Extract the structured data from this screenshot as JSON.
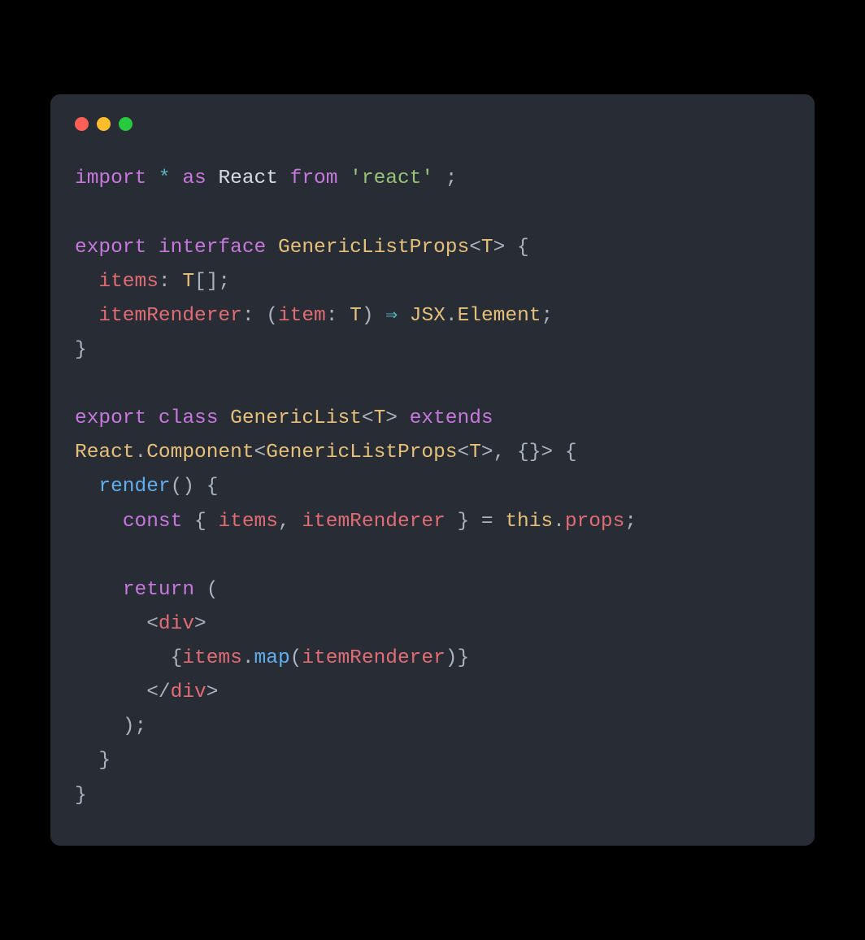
{
  "colors": {
    "bg": "#282C34",
    "red": "#FF5F56",
    "yellow": "#FFBD2E",
    "green": "#27C93F"
  },
  "tokens": [
    [
      [
        "import",
        "kw"
      ],
      [
        " ",
        ""
      ],
      [
        "*",
        "op"
      ],
      [
        " ",
        ""
      ],
      [
        "as",
        "kw"
      ],
      [
        " ",
        ""
      ],
      [
        "React",
        "white"
      ],
      [
        " ",
        ""
      ],
      [
        "from",
        "kw"
      ],
      [
        " ",
        ""
      ],
      [
        "'react'",
        "str"
      ],
      [
        " ;",
        ""
      ]
    ],
    [],
    [
      [
        "export",
        "kw"
      ],
      [
        " ",
        ""
      ],
      [
        "interface",
        "kw"
      ],
      [
        " ",
        ""
      ],
      [
        "GenericListProps",
        "type"
      ],
      [
        "<",
        ""
      ],
      [
        "T",
        "type"
      ],
      [
        ">",
        ""
      ],
      [
        " {",
        ""
      ]
    ],
    [
      [
        "  ",
        ""
      ],
      [
        "items",
        "ident"
      ],
      [
        ": ",
        ""
      ],
      [
        "T",
        "type"
      ],
      [
        "[];",
        ""
      ]
    ],
    [
      [
        "  ",
        ""
      ],
      [
        "itemRenderer",
        "ident"
      ],
      [
        ": (",
        ""
      ],
      [
        "item",
        "ident"
      ],
      [
        ": ",
        ""
      ],
      [
        "T",
        "type"
      ],
      [
        ") ",
        ""
      ],
      [
        "⇒",
        "op"
      ],
      [
        " ",
        ""
      ],
      [
        "JSX",
        "type"
      ],
      [
        ".",
        ""
      ],
      [
        "Element",
        "type"
      ],
      [
        ";",
        ""
      ]
    ],
    [
      [
        "}",
        ""
      ]
    ],
    [],
    [
      [
        "export",
        "kw"
      ],
      [
        " ",
        ""
      ],
      [
        "class",
        "kw"
      ],
      [
        " ",
        ""
      ],
      [
        "GenericList",
        "type"
      ],
      [
        "<",
        ""
      ],
      [
        "T",
        "type"
      ],
      [
        ">",
        ""
      ],
      [
        " ",
        ""
      ],
      [
        "extends",
        "kw"
      ],
      [
        " ",
        ""
      ],
      [
        "React",
        "type"
      ],
      [
        ".",
        ""
      ],
      [
        "Component",
        "type"
      ],
      [
        "<",
        ""
      ],
      [
        "GenericListProps",
        "type"
      ],
      [
        "<",
        ""
      ],
      [
        "T",
        "type"
      ],
      [
        ">",
        ""
      ],
      [
        ", {}> {",
        ""
      ]
    ],
    [
      [
        "  ",
        ""
      ],
      [
        "render",
        "fn"
      ],
      [
        "() {",
        ""
      ]
    ],
    [
      [
        "    ",
        ""
      ],
      [
        "const",
        "kw"
      ],
      [
        " { ",
        ""
      ],
      [
        "items",
        "ident"
      ],
      [
        ", ",
        ""
      ],
      [
        "itemRenderer",
        "ident"
      ],
      [
        " } = ",
        ""
      ],
      [
        "this",
        "thiskw"
      ],
      [
        ".",
        ""
      ],
      [
        "props",
        "ident"
      ],
      [
        ";",
        ""
      ]
    ],
    [],
    [
      [
        "    ",
        ""
      ],
      [
        "return",
        "kw"
      ],
      [
        " (",
        ""
      ]
    ],
    [
      [
        "      <",
        ""
      ],
      [
        "div",
        "tag"
      ],
      [
        ">",
        ""
      ]
    ],
    [
      [
        "        {",
        ""
      ],
      [
        "items",
        "ident"
      ],
      [
        ".",
        ""
      ],
      [
        "map",
        "fn"
      ],
      [
        "(",
        ""
      ],
      [
        "itemRenderer",
        "ident"
      ],
      [
        ")}",
        ""
      ]
    ],
    [
      [
        "      </",
        ""
      ],
      [
        "div",
        "tag"
      ],
      [
        ">",
        ""
      ]
    ],
    [
      [
        "    );",
        ""
      ]
    ],
    [
      [
        "  }",
        ""
      ]
    ],
    [
      [
        "}",
        ""
      ]
    ]
  ]
}
